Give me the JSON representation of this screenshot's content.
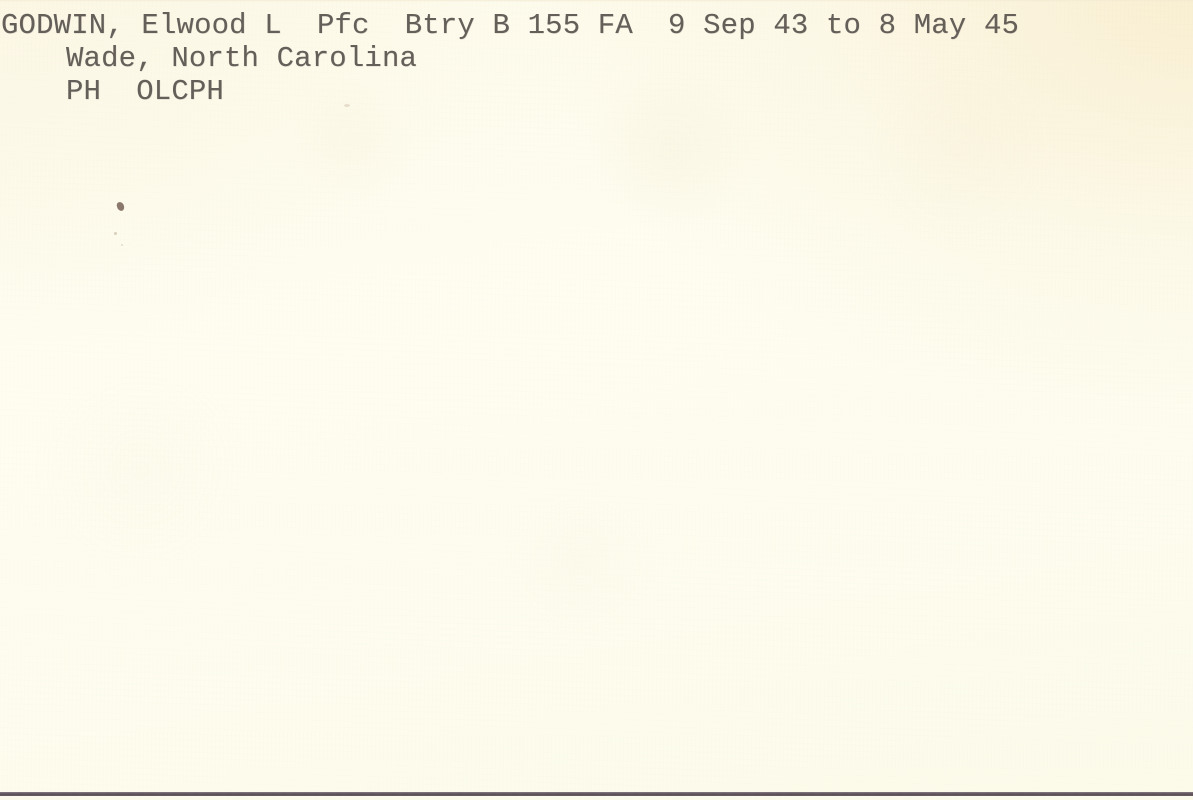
{
  "document": {
    "type": "index-card",
    "medium": "typewritten",
    "ink_color": "#5a544f",
    "paper_color": "#fdfcec",
    "scan_edge_color": "#4b4149",
    "lines": [
      "GODWIN, Elwood L  Pfc  Btry B 155 FA  9 Sep 43 to 8 May 45",
      "Wade, North Carolina",
      "PH  OLCPH"
    ],
    "line_1": "GODWIN, Elwood L  Pfc  Btry B 155 FA  9 Sep 43 to 8 May 45",
    "line_2": "Wade, North Carolina",
    "line_3": "PH  OLCPH",
    "fields": {
      "surname": "GODWIN",
      "given_name": "Elwood L",
      "rank": "Pfc",
      "unit": "Btry B 155 FA",
      "service_start": "9 Sep 43",
      "service_end": "8 May 45",
      "service_range": "9 Sep 43 to 8 May 45",
      "hometown": "Wade, North Carolina",
      "awards": "PH  OLCPH"
    }
  }
}
